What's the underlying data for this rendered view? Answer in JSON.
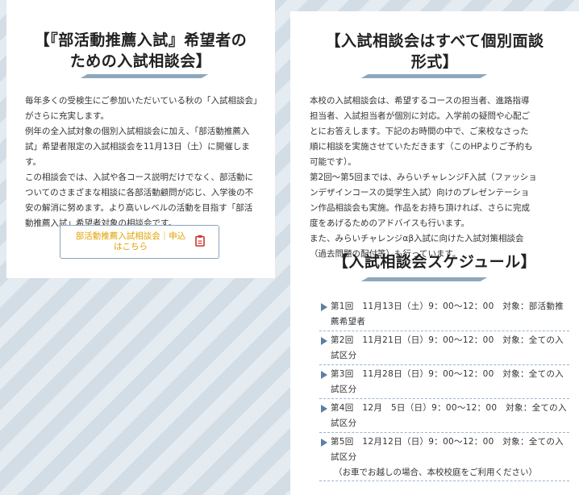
{
  "left": {
    "heading_line1": "【『部活動推薦入試』希望者の",
    "heading_line2": "ための入試相談会】",
    "paragraphs": [
      "毎年多くの受検生にご参加いただいている秋の「入試相談会」がさらに充実します。",
      "例年の全入試対象の個別入試相談会に加え、「部活動推薦入試」希望者限定の入試相談会を11月13日（土）に開催します。",
      "この相談会では、入試や各コース説明だけでなく、部活動についてのさまざまな相談に各部活動顧問が応じ、入学後の不安の解消に努めます。より高いレベルの活動を目指す「部活動推薦入試」希望者対象の相談会です。"
    ],
    "button_label": "部活動推薦入試相談会｜申込はこちら",
    "button_icon": "clipboard-icon"
  },
  "right": {
    "heading_line1": "【入試相談会はすべて個別面談",
    "heading_line2": "形式】",
    "paragraphs": [
      "本校の入試相談会は、希望するコースの担当者、進路指導担当者、入試担当者が個別に対応。入学前の疑問や心配ごとにお答えします。下記のお時間の中で、ご来校なさった順に相談を実施させていただきます（このHPよりご予約も可能です）。",
      "第2回～第5回までは、みらいチャレンジF入試（ファッションデザインコースの奨学生入試）向けのプレゼンテーション作品相談会も実施。作品をお持ち頂ければ、さらに完成度をあげるためのアドバイスも行います。",
      "また、みらいチャレンジαβ入試に向けた入試対策相談会（過去問題の配付等）も行っています。"
    ],
    "schedule_heading": "【入試相談会スケジュール】",
    "schedule": [
      {
        "text": "第1回　11月13日（土）9：00～12：00　対象：部活動推薦希望者"
      },
      {
        "text": "第2回　11月21日（日）9：00～12：00　対象：全ての入試区分"
      },
      {
        "text": "第3回　11月28日（日）9：00～12：00　対象：全ての入試区分"
      },
      {
        "text": "第4回　12月　5日（日）9：00～12：00　対象：全ての入試区分"
      },
      {
        "text": "第5回　12月12日（日）9：00～12：00　対象：全ての入試区分",
        "note": "（お車でお越しの場合、本校校庭をご利用ください）"
      }
    ]
  },
  "colors": {
    "accent_blue": "#8fa7bb",
    "button_text": "#e0a200",
    "icon_red": "#d0312d",
    "marker": "#5d7fa0"
  }
}
